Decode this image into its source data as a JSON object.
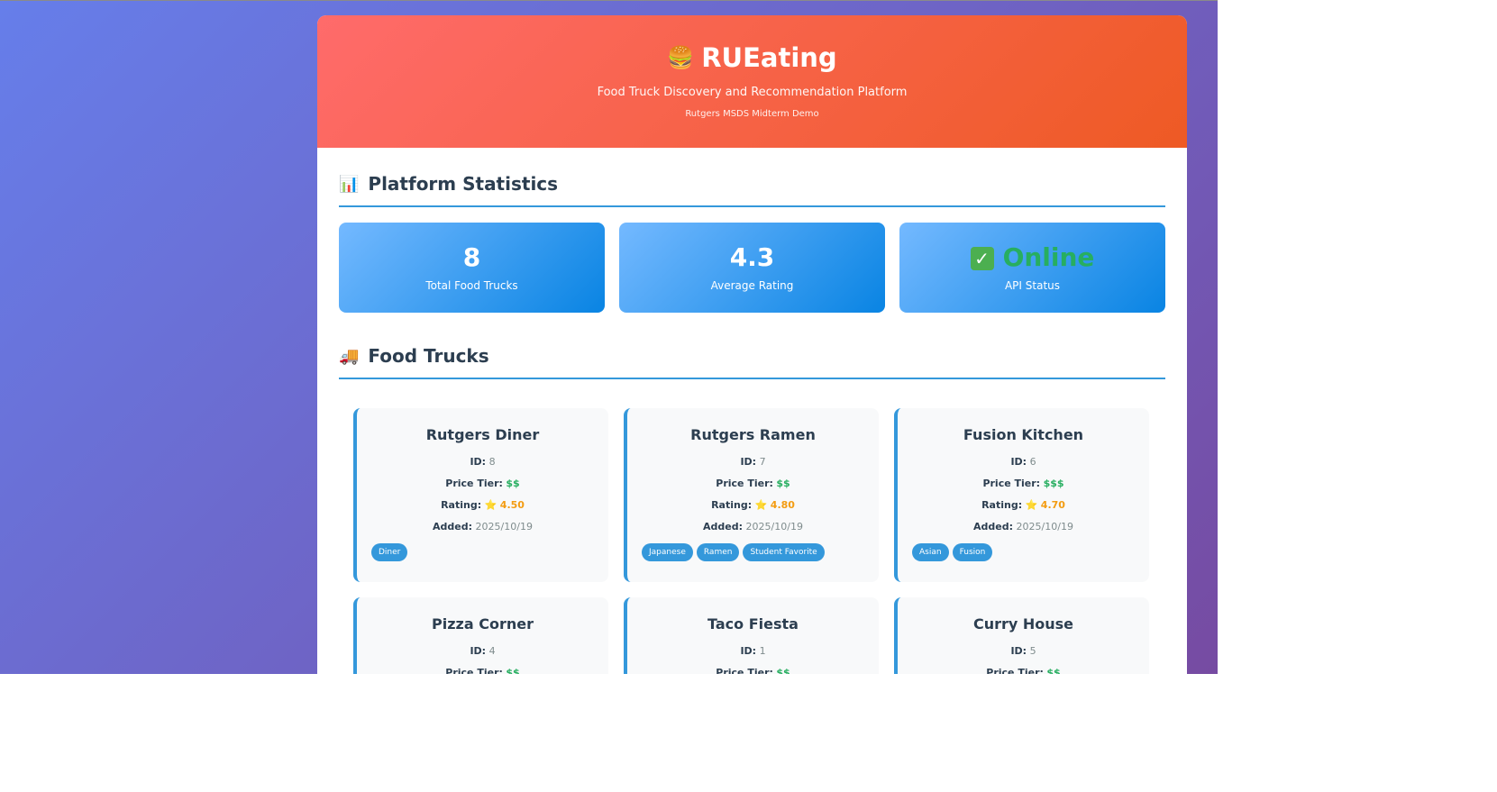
{
  "header": {
    "logo_emoji": "🍔",
    "title": "RUEating",
    "subtitle": "Food Truck Discovery and Recommendation Platform",
    "caption": "Rutgers MSDS Midterm Demo"
  },
  "stats_section": {
    "icon": "📊",
    "title": "Platform Statistics",
    "cards": [
      {
        "value": "8",
        "label": "Total Food Trucks"
      },
      {
        "value": "4.3",
        "label": "Average Rating"
      },
      {
        "value": "Online",
        "label": "API Status",
        "icon": "check-mark-icon"
      }
    ]
  },
  "trucks_section": {
    "icon": "🚚",
    "title": "Food Trucks",
    "labels": {
      "id": "ID:",
      "price": "Price Tier:",
      "rating": "Rating:",
      "added": "Added:"
    },
    "star_icon": "⭐",
    "trucks": [
      {
        "name": "Rutgers Diner",
        "id": "8",
        "price": "$$",
        "rating": "4.50",
        "added": "2025/10/19",
        "tags": [
          "Diner"
        ]
      },
      {
        "name": "Rutgers Ramen",
        "id": "7",
        "price": "$$",
        "rating": "4.80",
        "added": "2025/10/19",
        "tags": [
          "Japanese",
          "Ramen",
          "Student Favorite"
        ]
      },
      {
        "name": "Fusion Kitchen",
        "id": "6",
        "price": "$$$",
        "rating": "4.70",
        "added": "2025/10/19",
        "tags": [
          "Asian",
          "Fusion"
        ]
      },
      {
        "name": "Pizza Corner",
        "id": "4",
        "price": "$$"
      },
      {
        "name": "Taco Fiesta",
        "id": "1",
        "price": "$$"
      },
      {
        "name": "Curry House",
        "id": "5",
        "price": "$$"
      }
    ]
  },
  "colors": {
    "background_start": "#667eea",
    "background_end": "#764ba2",
    "header_start": "#ff6b6b",
    "header_end": "#ee5a24",
    "accent": "#3498db",
    "price": "#27ae60",
    "rating": "#f39c12"
  }
}
